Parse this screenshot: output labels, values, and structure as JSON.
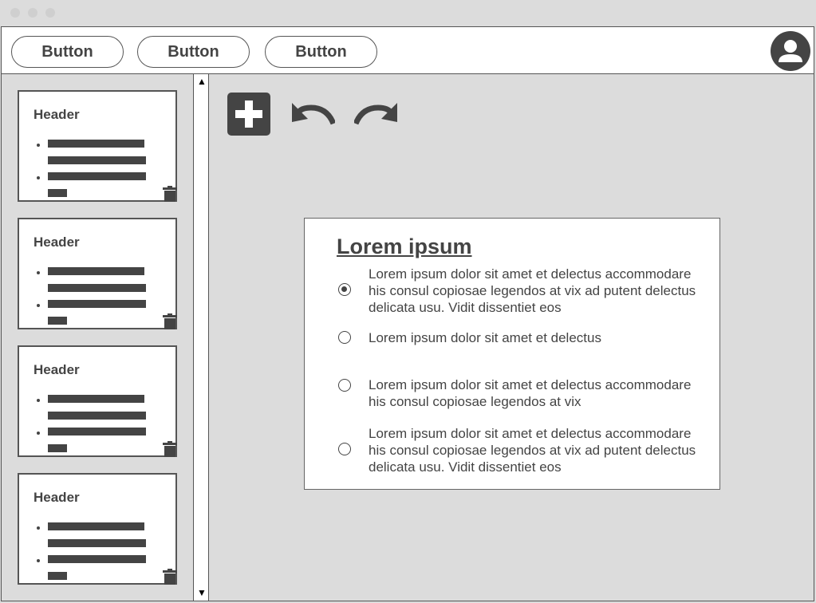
{
  "toolbar": {
    "buttons": [
      "Button",
      "Button",
      "Button"
    ]
  },
  "sidebar": {
    "cards": [
      {
        "header": "Header"
      },
      {
        "header": "Header"
      },
      {
        "header": "Header"
      },
      {
        "header": "Header"
      }
    ],
    "scroll_up": "▲",
    "scroll_down": "▼"
  },
  "icons": {
    "add": "plus-icon",
    "undo": "undo-icon",
    "redo": "redo-icon",
    "delete": "trash-icon",
    "user": "user-avatar-icon"
  },
  "panel": {
    "title": "Lorem ipsum",
    "options": [
      {
        "text": "Lorem ipsum dolor sit amet et delectus accommodare his consul copiosae legendos at vix ad putent delectus delicata usu. Vidit dissentiet eos",
        "selected": true
      },
      {
        "text": "Lorem ipsum dolor sit amet et delectus",
        "selected": false
      },
      {
        "text": "Lorem ipsum dolor sit amet et delectus accommodare his consul copiosae legendos at vix",
        "selected": false
      },
      {
        "text": "Lorem ipsum dolor sit amet et delectus accommodare his consul copiosae legendos at vix ad putent delectus delicata usu. Vidit dissentiet eos",
        "selected": false
      }
    ]
  },
  "colors": {
    "background": "#dcdcdc",
    "ink": "#444444",
    "border": "#555555"
  }
}
